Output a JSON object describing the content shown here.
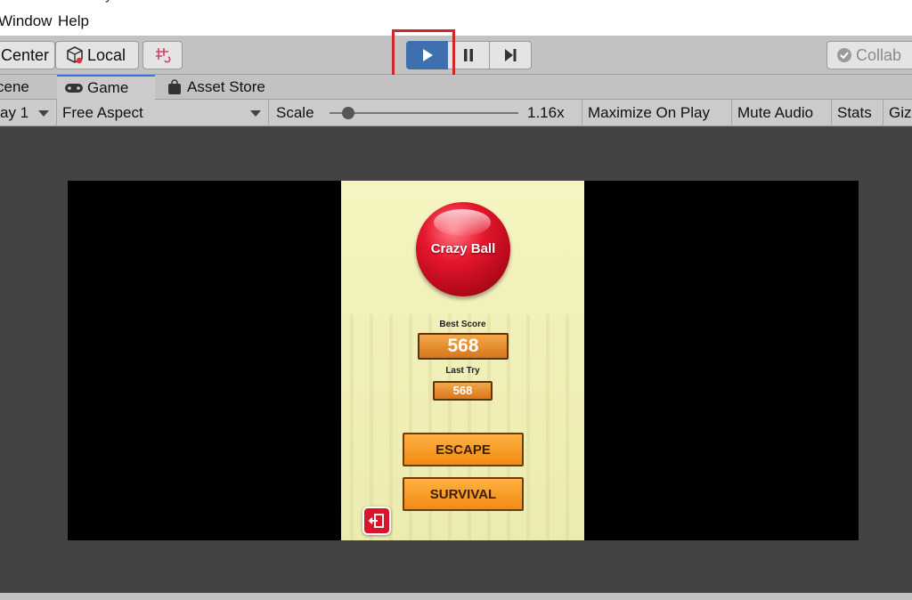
{
  "menubar": {
    "title_fragment": "y",
    "items": [
      {
        "label": "Window"
      },
      {
        "label": "Help"
      }
    ]
  },
  "toolbar": {
    "pivot_label": "Center",
    "space_label": "Local",
    "snap_icon": "grid-snap-icon",
    "play_icon": "play-icon",
    "pause_icon": "pause-icon",
    "step_icon": "step-icon",
    "collab_label": "Collab",
    "play_color": "#3e6fae",
    "highlight_color": "#d0282a"
  },
  "tabs": [
    {
      "label": "cene"
    },
    {
      "label": "Game",
      "icon": "gamepad-icon"
    },
    {
      "label": "Asset Store",
      "icon": "shopping-bag-icon"
    }
  ],
  "game_toolbar": {
    "display": "ay 1",
    "aspect": "Free Aspect",
    "scale_label": "Scale",
    "scale_value": "1.16x",
    "maximize": "Maximize On Play",
    "mute": "Mute Audio",
    "stats": "Stats",
    "gizmos": "Giz"
  },
  "game": {
    "title": "Crazy Ball",
    "best_score_label": "Best Score",
    "best_score": "568",
    "last_try_label": "Last Try",
    "last_try": "568",
    "escape_label": "ESCAPE",
    "survival_label": "SURVIVAL",
    "exit_icon": "exit-door-icon"
  }
}
